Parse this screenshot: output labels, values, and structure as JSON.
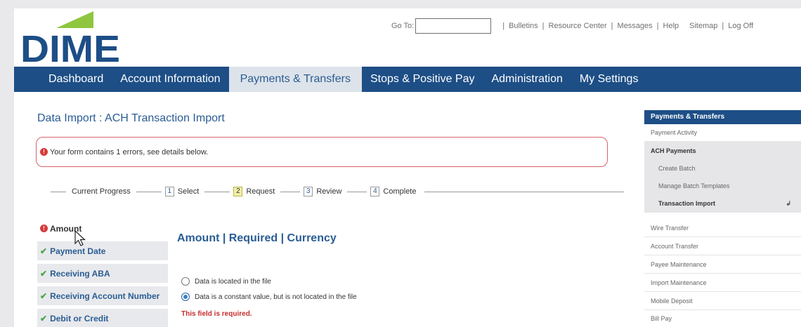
{
  "header": {
    "logo_text": "DIME",
    "goto_label": "Go To:",
    "goto_value": "",
    "links": [
      "Bulletins",
      "Resource Center",
      "Messages",
      "Help",
      "Sitemap",
      "Log Off"
    ]
  },
  "nav": {
    "items": [
      "Dashboard",
      "Account Information",
      "Payments & Transfers",
      "Stops & Positive Pay",
      "Administration",
      "My Settings"
    ],
    "active": "Payments & Transfers"
  },
  "page": {
    "title": "Data Import : ACH Transaction Import",
    "error_text": "Your form contains 1 errors, see details below.",
    "error_icon": "error-icon"
  },
  "progress": {
    "label": "Current Progress",
    "steps": [
      {
        "num": "1",
        "label": "Select"
      },
      {
        "num": "2",
        "label": "Request"
      },
      {
        "num": "3",
        "label": "Review"
      },
      {
        "num": "4",
        "label": "Complete"
      }
    ],
    "current": "2"
  },
  "fields": [
    {
      "label": "Amount",
      "status": "error"
    },
    {
      "label": "Payment Date",
      "status": "done"
    },
    {
      "label": "Receiving ABA",
      "status": "done"
    },
    {
      "label": "Receiving Account Number",
      "status": "done"
    },
    {
      "label": "Debit or Credit",
      "status": "done"
    }
  ],
  "form": {
    "section_title": "Amount | Required | Currency",
    "options": [
      {
        "label": "Data is located in the file",
        "checked": false
      },
      {
        "label": "Data is a constant value, but is not located in the file",
        "checked": true
      }
    ],
    "required_msg": "This field is required."
  },
  "sidebar": {
    "header": "Payments & Transfers",
    "payment_activity": "Payment Activity",
    "ach_header": "ACH Payments",
    "ach_items": [
      "Create Batch",
      "Manage Batch Templates",
      "Transaction Import"
    ],
    "items": [
      "Wire Transfer",
      "Account Transfer",
      "Payee Maintenance",
      "Import Maintenance",
      "Mobile Deposit",
      "Bill Pay"
    ]
  },
  "colors": {
    "nav_blue": "#1d4e86",
    "logo_green": "#8fc63f",
    "error_red": "#d63b3b",
    "check_green": "#4aa54a"
  }
}
